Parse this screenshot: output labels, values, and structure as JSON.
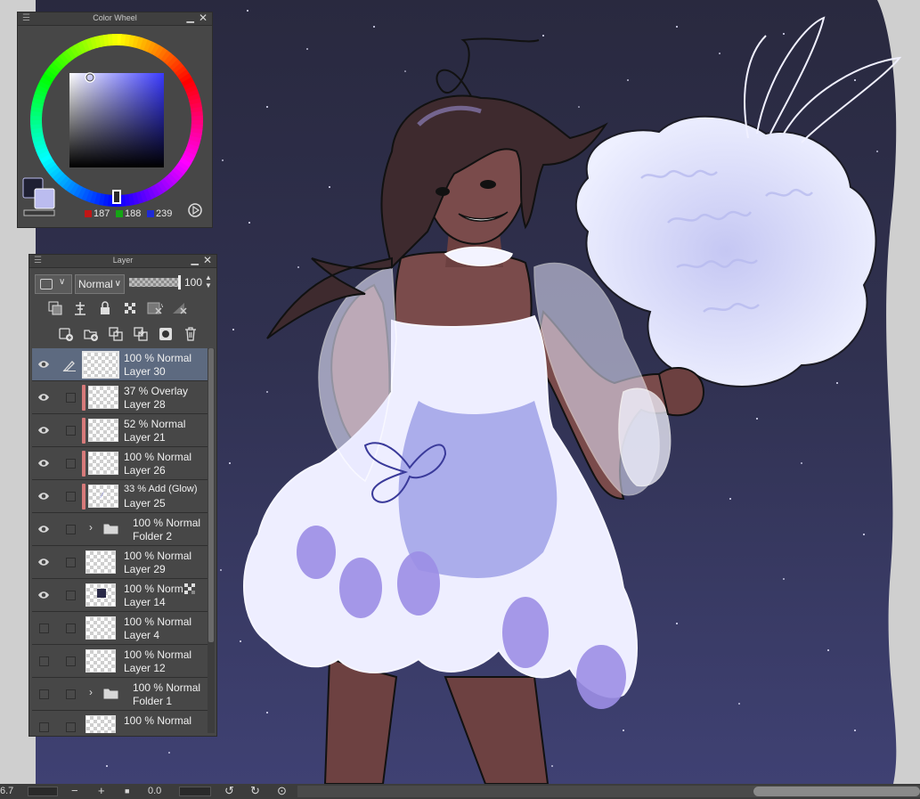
{
  "color_wheel": {
    "title": "Color Wheel",
    "rgb": {
      "r": "187",
      "g": "188",
      "b": "239"
    },
    "main_color": "#1f2033",
    "sub_color": "#bbbcef",
    "rgb_swatch_colors": [
      "#c01616",
      "#14a514",
      "#1e2ad6"
    ]
  },
  "layer_panel": {
    "title": "Layer",
    "blend_mode": "Normal",
    "opacity": "100",
    "layers": [
      {
        "kind": "layer",
        "line1": "100 % Normal",
        "line2": "Layer 30",
        "visible": true,
        "selected": true,
        "clipped": false,
        "pen": true
      },
      {
        "kind": "layer",
        "line1": "37 % Overlay",
        "line2": "Layer 28",
        "visible": true,
        "selected": false,
        "clipped": true
      },
      {
        "kind": "layer",
        "line1": "52 % Normal",
        "line2": "Layer 21",
        "visible": true,
        "selected": false,
        "clipped": true
      },
      {
        "kind": "layer",
        "line1": "100 % Normal",
        "line2": "Layer 26",
        "visible": true,
        "selected": false,
        "clipped": true
      },
      {
        "kind": "layer",
        "line1": "33 % Add (Glow)",
        "line2": "Layer 25",
        "visible": true,
        "selected": false,
        "clipped": true
      },
      {
        "kind": "folder",
        "line1": "100 % Normal",
        "line2": "Folder 2",
        "visible": true
      },
      {
        "kind": "layer",
        "line1": "100 % Normal",
        "line2": "Layer 29",
        "visible": true,
        "selected": false,
        "clipped": false
      },
      {
        "kind": "layer",
        "line1": "100 % Norm",
        "line2": "Layer 14",
        "visible": true,
        "selected": false,
        "clipped": false,
        "mask": true
      },
      {
        "kind": "layer",
        "line1": "100 % Normal",
        "line2": "Layer 4",
        "visible": false,
        "selected": false,
        "clipped": false
      },
      {
        "kind": "layer",
        "line1": "100 % Normal",
        "line2": "Layer 12",
        "visible": false,
        "selected": false,
        "clipped": false
      },
      {
        "kind": "folder",
        "line1": "100 % Normal",
        "line2": "Folder 1",
        "visible": false
      },
      {
        "kind": "layer",
        "line1": "100 % Normal",
        "line2": "",
        "visible": false,
        "selected": false,
        "clipped": false
      }
    ]
  },
  "status_bar": {
    "zoom": "6.7",
    "zoom_out": "−",
    "zoom_in": "+",
    "angle": "0.0"
  },
  "colors": {
    "sky_top": "#2b2b45",
    "sky_bottom": "#3d3f70",
    "dress": "#eeeefe",
    "skin": "#7a4b4b",
    "hair": "#3e2a2e"
  }
}
